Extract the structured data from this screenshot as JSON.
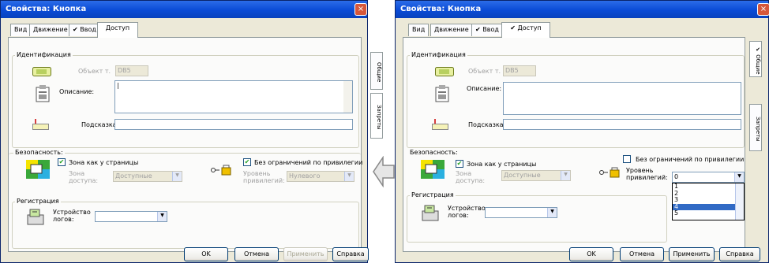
{
  "left": {
    "title": "Свойства: Кнопка",
    "close": "×",
    "tabs": [
      {
        "label": "Вид"
      },
      {
        "label": "Движение"
      },
      {
        "label": "✔ Ввод"
      },
      {
        "label": "Доступ"
      }
    ],
    "side_tabs": [
      "Общие",
      "Запреты"
    ],
    "identification": {
      "title": "Идентификация",
      "object_label": "Объект т.",
      "object_value": "DB5",
      "description_label": "Описание:",
      "tooltip_label": "Подсказка:"
    },
    "security": {
      "title": "Безопасность:",
      "zone_checkbox": "Зона как у страницы",
      "zone_label": "Зона доступа:",
      "zone_value": "Доступные",
      "no_priv_checkbox": "Без ограничений по привилегии",
      "level_label": "Уровень привилегий:",
      "level_value": "Нулевого"
    },
    "registration": {
      "title": "Регистрация",
      "device_label": "Устройство логов:"
    },
    "buttons": {
      "ok": "OK",
      "cancel": "Отмена",
      "apply": "Применить",
      "help": "Справка"
    }
  },
  "right": {
    "title": "Свойства: Кнопка",
    "close": "×",
    "tabs": [
      {
        "label": "Вид"
      },
      {
        "label": "Движение"
      },
      {
        "label": "✔ Ввод"
      },
      {
        "label": "✔ Доступ"
      }
    ],
    "side_tabs": [
      "✔ Общие",
      "Запреты"
    ],
    "identification": {
      "title": "Идентификация",
      "object_label": "Объект т.",
      "object_value": "DB5",
      "description_label": "Описание:",
      "tooltip_label": "Подсказка:"
    },
    "security": {
      "title": "Безопасность:",
      "zone_checkbox": "Зона как у страницы",
      "zone_label": "Зона доступа:",
      "zone_value": "Доступные",
      "no_priv_checkbox": "Без ограничений по привилегии",
      "level_label": "Уровень привилегий:",
      "level_value": "0",
      "level_options": [
        "1",
        "2",
        "3",
        "4",
        "5"
      ],
      "level_selected": "4"
    },
    "registration": {
      "title": "Регистрация",
      "device_label": "Устройство логов:"
    },
    "buttons": {
      "ok": "OK",
      "cancel": "Отмена",
      "apply": "Применить",
      "help": "Справка"
    }
  },
  "arrow": "back-arrow-icon"
}
